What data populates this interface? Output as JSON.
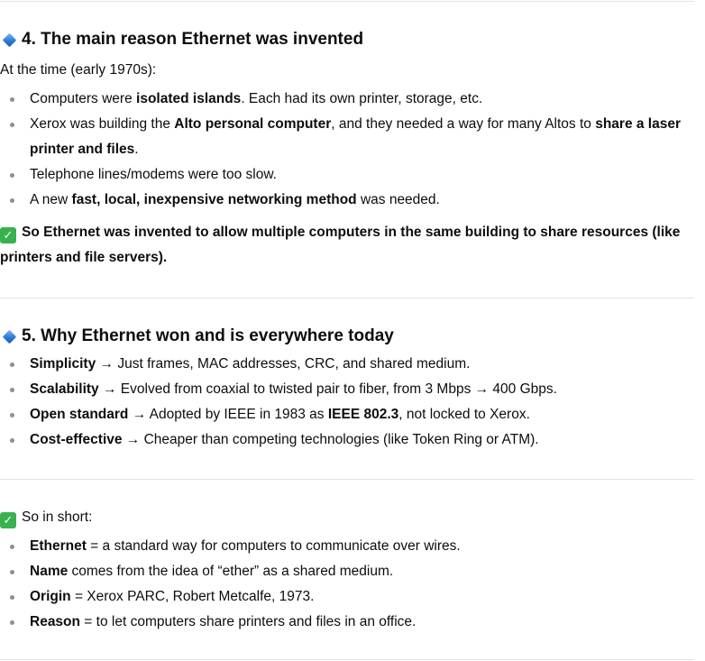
{
  "colors": {
    "text": "#0d0d0d",
    "divider": "#e3e3e3",
    "diamond": "#2d7ad6",
    "check": "#37b24d",
    "bullet": "#8f8f8f"
  },
  "icons": {
    "heading_icon": "small-blue-diamond-icon",
    "check_icon": "white-check-mark-icon",
    "check_glyph": "✓"
  },
  "section4": {
    "title": "4. The main reason Ethernet was invented",
    "intro": "At the time (early 1970s):",
    "bullets": [
      {
        "parts": [
          "Computers were ",
          "isolated islands",
          ". Each had its own printer, storage, etc."
        ]
      },
      {
        "parts": [
          "Xerox was building the ",
          "Alto personal computer",
          ", and they needed a way for many Altos to ",
          "share a laser printer and files",
          "."
        ]
      },
      {
        "parts": [
          "Telephone lines/modems were too slow."
        ]
      },
      {
        "parts": [
          "A new ",
          "fast, local, inexpensive networking method",
          " was needed."
        ]
      }
    ],
    "conclusion": "So Ethernet was invented to allow multiple computers in the same building to share resources (like printers and file servers)."
  },
  "section5": {
    "title": "5. Why Ethernet won and is everywhere today",
    "bullets": [
      {
        "term": "Simplicity",
        "text": " → Just frames, MAC addresses, CRC, and shared medium."
      },
      {
        "term": "Scalability",
        "text": " → Evolved from coaxial to twisted pair to fiber, from 3 Mbps → 400 Gbps."
      },
      {
        "term": "Open standard",
        "text": " → Adopted by IEEE in 1983 as ",
        "strong2": "IEEE 802.3",
        "text2": ", not locked to Xerox."
      },
      {
        "term": "Cost-effective",
        "text": " → Cheaper than competing technologies (like Token Ring or ATM)."
      }
    ]
  },
  "summary": {
    "title": "So in short:",
    "bullets": [
      {
        "term": "Ethernet",
        "text": " = a standard way for computers to communicate over wires."
      },
      {
        "term": "Name",
        "text": " comes from the idea of “ether” as a shared medium."
      },
      {
        "term": "Origin",
        "text": " = Xerox PARC, Robert Metcalfe, 1973."
      },
      {
        "term": "Reason",
        "text": " = to let computers share printers and files in an office."
      }
    ]
  }
}
